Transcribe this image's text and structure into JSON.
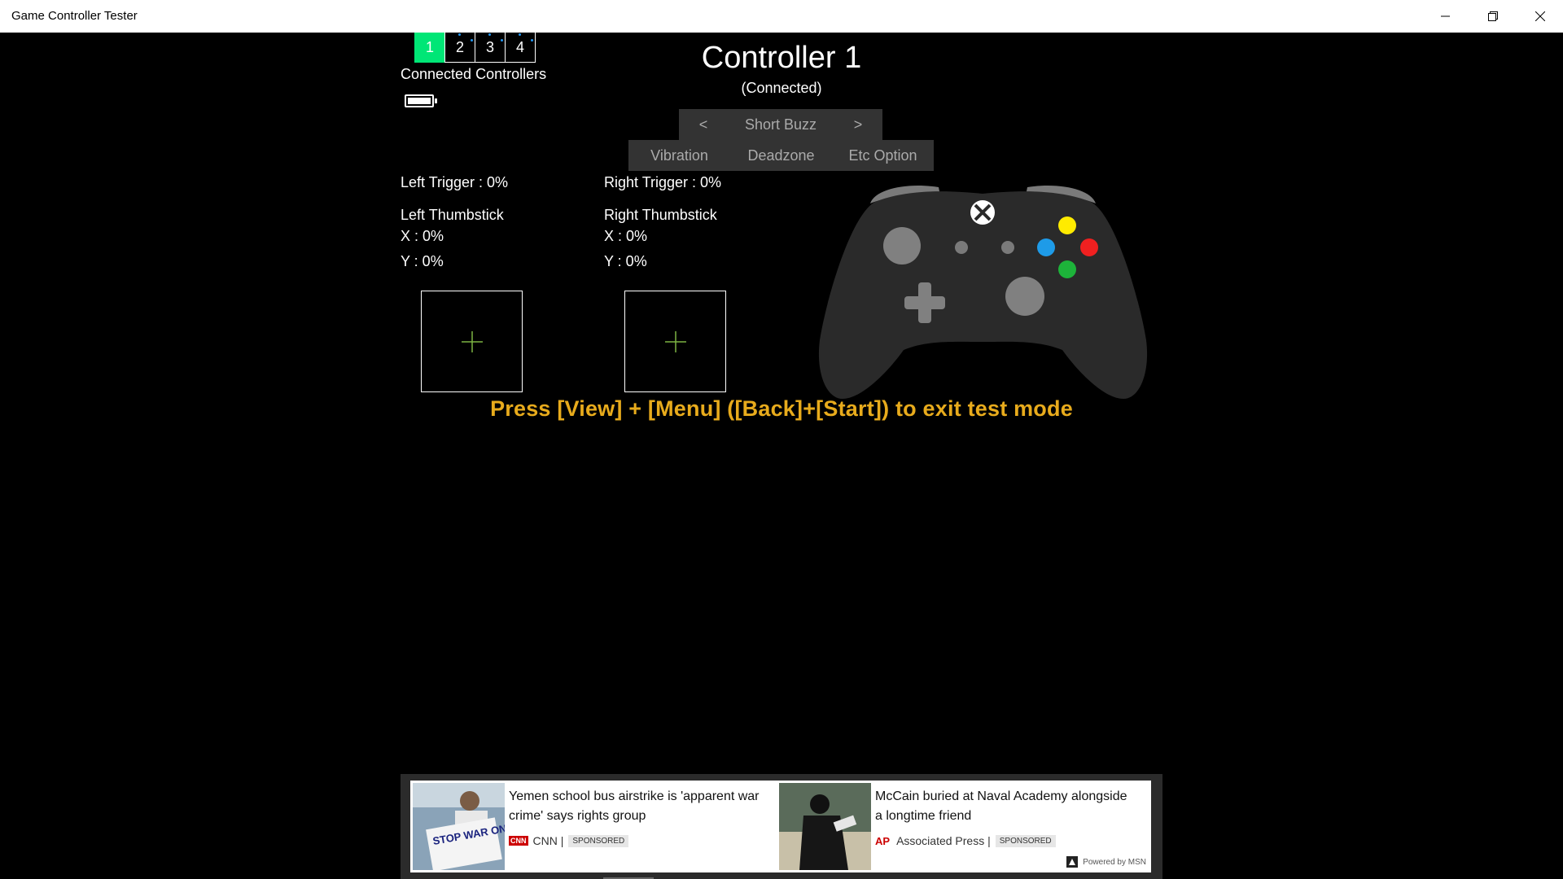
{
  "window": {
    "title": "Game Controller Tester"
  },
  "controllers": {
    "tabs": [
      "1",
      "2",
      "3",
      "4"
    ],
    "active_index": 0,
    "label": "Connected Controllers",
    "battery_level": 1.0
  },
  "header": {
    "title": "Controller 1",
    "status": "(Connected)"
  },
  "vibration_selector": {
    "prev": "<",
    "value": "Short Buzz",
    "next": ">"
  },
  "option_tabs": [
    "Vibration",
    "Deadzone",
    "Etc Option"
  ],
  "stats": {
    "left_trigger": "Left Trigger : 0%",
    "right_trigger": "Right Trigger : 0%",
    "left_thumb_title": "Left Thumbstick",
    "left_x": "X : 0%",
    "left_y": "Y : 0%",
    "right_thumb_title": "Right Thumbstick",
    "right_x": "X : 0%",
    "right_y": "Y : 0%"
  },
  "exit_message": "Press [View] + [Menu] ([Back]+[Start]) to exit test mode",
  "colors": {
    "active_tab": "#00e676",
    "crosshair": "#7cb342",
    "exit_text": "#e8ab1c",
    "button_y": "#ffeb00",
    "button_b": "#f02020",
    "button_x": "#1e9be8",
    "button_a": "#1db33a"
  },
  "ad": {
    "stories": [
      {
        "headline": "Yemen school bus airstrike is 'apparent war crime' says rights group",
        "source": "CNN |",
        "source_logo": "CNN",
        "badge": "SPONSORED",
        "image_text": "STOP WAR ON YEMEN"
      },
      {
        "headline": "McCain buried at Naval Academy alongside a longtime friend",
        "source": "Associated Press |",
        "source_logo": "AP",
        "badge": "SPONSORED"
      }
    ],
    "powered_by": "Powered by MSN"
  }
}
